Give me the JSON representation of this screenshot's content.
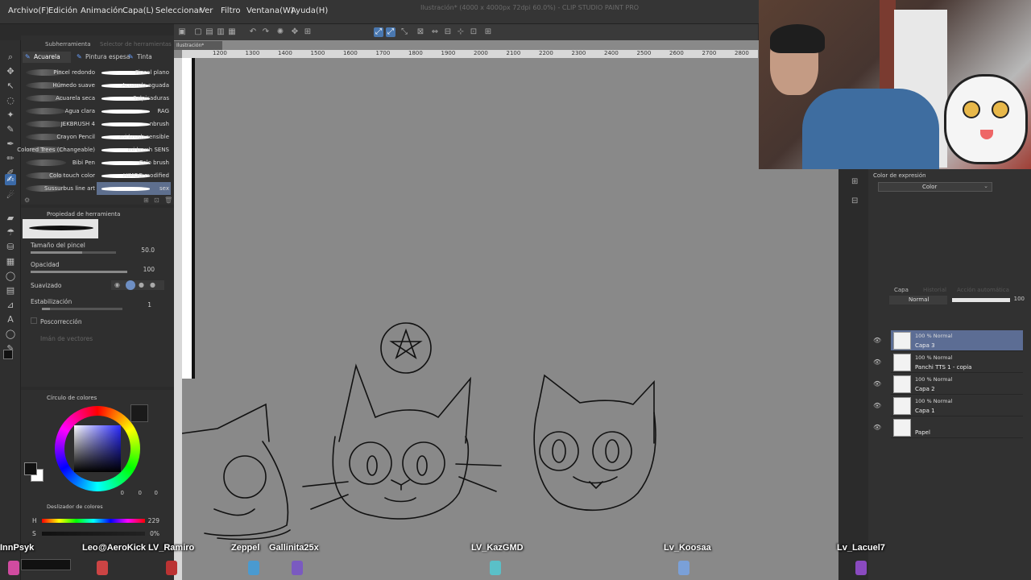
{
  "app": {
    "title": "Ilustración* (4000 x 4000px 72dpi 60.0%) - CLIP STUDIO PAINT PRO",
    "doc_tab": "Ilustración*"
  },
  "menu": [
    "Archivo(F)",
    "Edición",
    "Animación",
    "Capa(L)",
    "Seleccionar",
    "Ver",
    "Filtro",
    "Ventana(W)",
    "Ayuda(H)"
  ],
  "brush_panel": {
    "tabs": [
      "Subherramienta",
      "Selector de herramientas"
    ],
    "categories": [
      "Acuarela",
      "Pintura espesa",
      "Tinta"
    ],
    "left_column": [
      "Pincel redondo",
      "Húmedo suave",
      "Acuarela seca",
      "Agua clara",
      "JEKBRUSH 4",
      "Crayon Pencil",
      "Colored Trees (Changeable)",
      "Bibi Pen",
      "Colo touch color",
      "Sussurbus line art"
    ],
    "right_column": [
      "Pincel plano",
      "Acuarela aguada",
      "Salpicaduras",
      "RAG",
      "nbrush",
      "mi brush sensible",
      "mi brush SENS",
      "Colo brush",
      "HIMOG modified",
      "sex"
    ]
  },
  "tool_property": {
    "header": "Propiedad de herramienta",
    "size_label": "Tamaño del pincel",
    "size_value": "50.0",
    "opacity_label": "Opacidad",
    "opacity_value": "100",
    "smoothing_label": "Suavizado",
    "stabilization_label": "Estabilización",
    "stabilization_value": "1",
    "post_correction_label": "Poscorrección",
    "vector_magnet_label": "Imán de vectores"
  },
  "color_wheel": {
    "header": "Círculo de colores",
    "main_color": "#111111",
    "sub_color": "#ffffff",
    "values": [
      "0",
      "0",
      "0"
    ]
  },
  "color_slider": {
    "header": "Deslizador de colores",
    "h_label": "H",
    "s_label": "S",
    "h_value": "229",
    "s_value": "0%"
  },
  "ruler": {
    "ticks": [
      "1200",
      "1300",
      "1400",
      "1500",
      "1600",
      "1700",
      "1800",
      "1900",
      "2000",
      "2100",
      "2200",
      "2300",
      "2400",
      "2500",
      "2600",
      "2700",
      "2800"
    ]
  },
  "expression_color": {
    "label": "Color de expresión",
    "value": "Color"
  },
  "layer_panel": {
    "tabs": [
      "Capa",
      "Historial",
      "Acción automática"
    ],
    "blend_mode": "Normal",
    "opacity": "100",
    "layers": [
      {
        "mode": "100 % Normal",
        "name": "Capa 3",
        "selected": true
      },
      {
        "mode": "100 % Normal",
        "name": "Panchi TTS 1 - copia",
        "selected": false
      },
      {
        "mode": "100 % Normal",
        "name": "Capa 2",
        "selected": false
      },
      {
        "mode": "100 % Normal",
        "name": "Capa 1",
        "selected": false
      },
      {
        "mode": "",
        "name": "Papel",
        "selected": false
      }
    ]
  },
  "chat": {
    "names": [
      "InnPsyk",
      "Leo",
      "@AeroKick",
      "LV_Ramiro",
      "Zeppel",
      "Gallinita25x",
      "LV_KazGMD",
      "Lv_Koosaa",
      "Lv_Lacuel7"
    ]
  },
  "colors": {
    "menubar": "#353535",
    "canvas": "#898989",
    "selection": "#5c6d94",
    "accent": "#4a78b0"
  }
}
